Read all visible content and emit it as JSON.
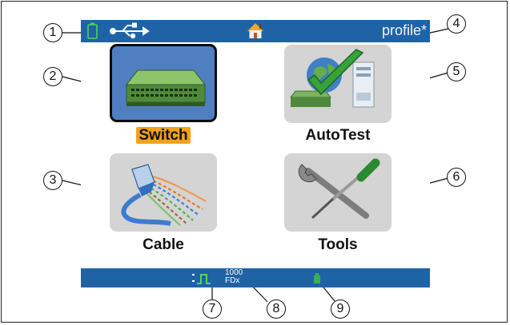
{
  "status_bar": {
    "profile_label": "profile*"
  },
  "tiles": [
    {
      "id": "switch",
      "label": "Switch",
      "selected": true
    },
    {
      "id": "autotest",
      "label": "AutoTest",
      "selected": false
    },
    {
      "id": "cable",
      "label": "Cable",
      "selected": false
    },
    {
      "id": "tools",
      "label": "Tools",
      "selected": false
    }
  ],
  "bottom_bar": {
    "link_speed": "1000",
    "duplex": "FDx"
  },
  "callouts": [
    "1",
    "2",
    "3",
    "4",
    "5",
    "6",
    "7",
    "8",
    "9"
  ],
  "colors": {
    "bar": "#1f63a6",
    "selected_tile": "#4f7fc0",
    "tile": "#d4d4d4",
    "highlight": "#f2a11b",
    "status_green": "#33b34a"
  },
  "icons": [
    "battery-icon",
    "usb-icon",
    "home-icon",
    "switch-device-icon",
    "autotest-icon",
    "cable-icon",
    "tools-icon",
    "link-pulse-icon",
    "power-icon"
  ]
}
